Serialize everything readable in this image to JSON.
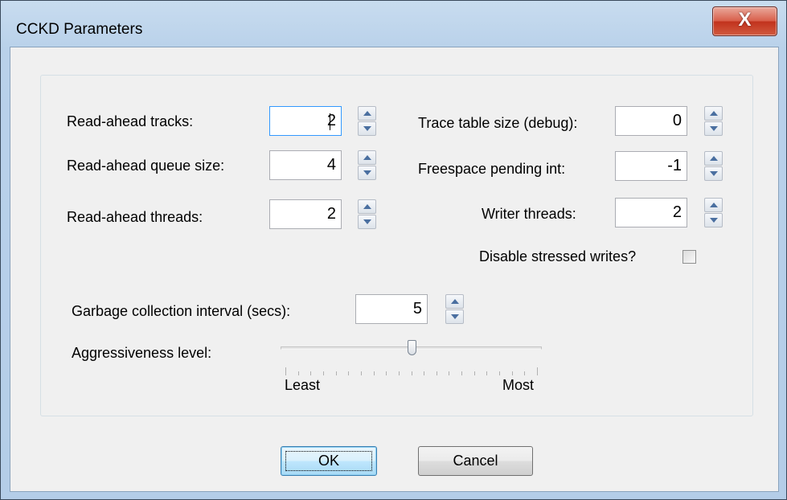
{
  "window": {
    "title": "CCKD Parameters",
    "close_glyph": "X"
  },
  "fields": {
    "read_ahead_tracks": {
      "label": "Read-ahead tracks:",
      "value": "2"
    },
    "read_ahead_queue_size": {
      "label": "Read-ahead queue size:",
      "value": "4"
    },
    "read_ahead_threads": {
      "label": "Read-ahead threads:",
      "value": "2"
    },
    "trace_table_size": {
      "label": "Trace table size (debug):",
      "value": "0"
    },
    "freespace_pending_int": {
      "label": "Freespace pending int:",
      "value": "-1"
    },
    "writer_threads": {
      "label": "Writer threads:",
      "value": "2"
    },
    "gc_interval": {
      "label": "Garbage collection interval (secs):",
      "value": "5"
    }
  },
  "disable_stressed_writes": {
    "label": "Disable stressed writes?",
    "checked": false
  },
  "aggressiveness": {
    "label": "Aggressiveness level:",
    "min_label": "Least",
    "max_label": "Most",
    "level_fraction": 0.5
  },
  "buttons": {
    "ok": "OK",
    "cancel": "Cancel"
  },
  "colors": {
    "title_bar": "#b9d1ea",
    "close_button": "#c7402c",
    "dialog_face": "#f0f0f0",
    "default_button": "#bee6fd",
    "spin_arrow": "#4a6fa0"
  },
  "icons": [
    "close-icon",
    "spin-up-arrow-icon",
    "spin-down-arrow-icon"
  ]
}
